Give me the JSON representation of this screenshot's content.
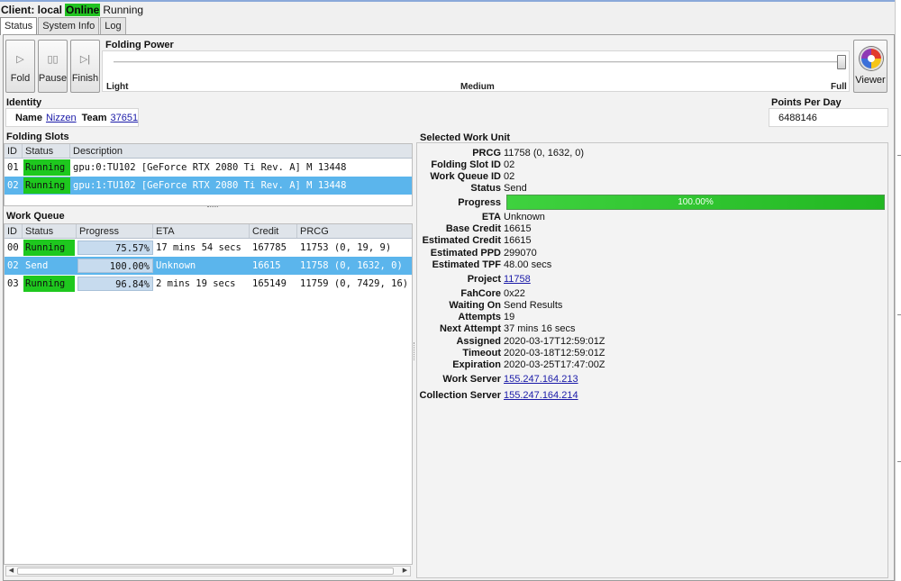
{
  "client": {
    "label": "Client: local",
    "connection": "Online",
    "state": "Running"
  },
  "tabs": [
    {
      "label": "Status"
    },
    {
      "label": "System Info"
    },
    {
      "label": "Log"
    }
  ],
  "toolbar": {
    "fold_label": "Fold",
    "pause_label": "Pause",
    "finish_label": "Finish",
    "viewer_label": "Viewer"
  },
  "folding_power": {
    "title": "Folding Power",
    "levels": [
      "Light",
      "Medium",
      "Full"
    ],
    "current": "Full",
    "level_fraction": 1.0
  },
  "identity": {
    "title": "Identity",
    "name_label": "Name",
    "name": "Nizzen",
    "team_label": "Team",
    "team": "37651"
  },
  "ppd": {
    "title": "Points Per Day",
    "value": "6488146"
  },
  "folding_slots": {
    "title": "Folding Slots",
    "columns": [
      "ID",
      "Status",
      "Description"
    ],
    "rows": [
      {
        "id": "01",
        "status": "Running",
        "description": "gpu:0:TU102 [GeForce RTX 2080 Ti Rev. A] M 13448"
      },
      {
        "id": "02",
        "status": "Running",
        "description": "gpu:1:TU102 [GeForce RTX 2080 Ti Rev. A] M 13448"
      }
    ]
  },
  "work_queue": {
    "title": "Work Queue",
    "columns": [
      "ID",
      "Status",
      "Progress",
      "ETA",
      "Credit",
      "PRCG"
    ],
    "rows": [
      {
        "id": "00",
        "status": "Running",
        "progress": "75.57%",
        "eta": "17 mins 54 secs",
        "credit": "167785",
        "prcg": "11753 (0, 19, 9)"
      },
      {
        "id": "02",
        "status": "Send",
        "progress": "100.00%",
        "eta": "Unknown",
        "credit": "16615",
        "prcg": "11758 (0, 1632, 0)"
      },
      {
        "id": "03",
        "status": "Running",
        "progress": "96.84%",
        "eta": "2 mins 19 secs",
        "credit": "165149",
        "prcg": "11759 (0, 7429, 16)"
      }
    ]
  },
  "selected_work_unit": {
    "title": "Selected Work Unit",
    "progress_label": "Progress",
    "progress_text": "100.00%",
    "progress_fraction": 1.0,
    "fields": {
      "prcg": {
        "label": "PRCG",
        "value": "11758 (0, 1632, 0)"
      },
      "folding_slot_id": {
        "label": "Folding Slot ID",
        "value": "02"
      },
      "work_queue_id": {
        "label": "Work Queue ID",
        "value": "02"
      },
      "status": {
        "label": "Status",
        "value": "Send"
      },
      "eta": {
        "label": "ETA",
        "value": "Unknown"
      },
      "base_credit": {
        "label": "Base Credit",
        "value": "16615"
      },
      "estimated_credit": {
        "label": "Estimated Credit",
        "value": "16615"
      },
      "estimated_ppd": {
        "label": "Estimated PPD",
        "value": "299070"
      },
      "estimated_tpf": {
        "label": "Estimated TPF",
        "value": "48.00 secs"
      },
      "project": {
        "label": "Project",
        "value": "11758"
      },
      "fahcore": {
        "label": "FahCore",
        "value": "0x22"
      },
      "waiting_on": {
        "label": "Waiting On",
        "value": "Send Results"
      },
      "attempts": {
        "label": "Attempts",
        "value": "19"
      },
      "next_attempt": {
        "label": "Next Attempt",
        "value": "37 mins 16 secs"
      },
      "assigned": {
        "label": "Assigned",
        "value": "2020-03-17T12:59:01Z"
      },
      "timeout": {
        "label": "Timeout",
        "value": "2020-03-18T12:59:01Z"
      },
      "expiration": {
        "label": "Expiration",
        "value": "2020-03-25T17:47:00Z"
      },
      "work_server": {
        "label": "Work Server",
        "value": "155.247.164.213"
      },
      "collection_server": {
        "label": "Collection Server",
        "value": "155.247.164.214"
      }
    }
  },
  "icons": {
    "fold": "play-icon",
    "pause": "pause-icon",
    "finish": "finish-icon",
    "viewer": "viewer-logo-icon"
  },
  "colors": {
    "running": "#1ec81e",
    "selected_row": "#5bb5ec",
    "progress_fill": "#2cc32c",
    "link": "#1a1aa8"
  }
}
